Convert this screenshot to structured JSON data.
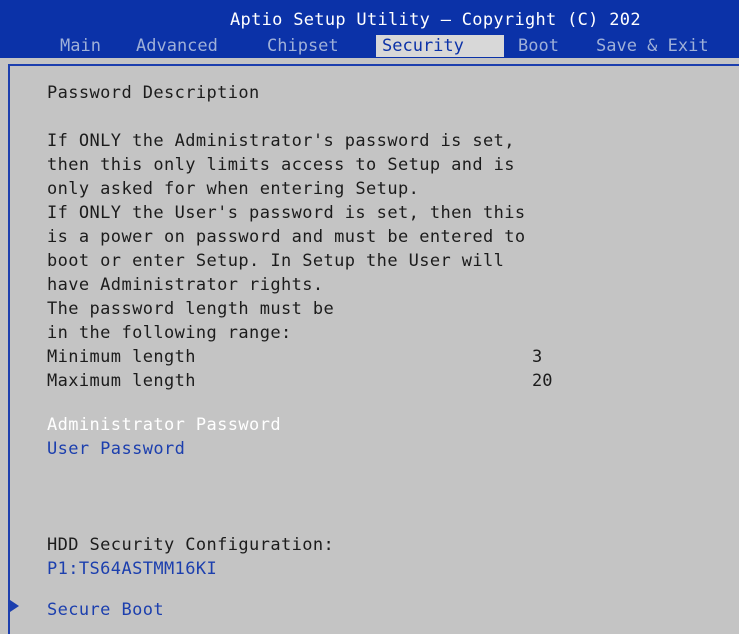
{
  "header": {
    "title": "Aptio Setup Utility – Copyright (C) 202",
    "tabs": [
      {
        "label": "Main"
      },
      {
        "label": "Advanced"
      },
      {
        "label": "Chipset"
      },
      {
        "label": "Security"
      },
      {
        "label": "Boot"
      },
      {
        "label": "Save & Exit"
      }
    ],
    "active_tab": "Security"
  },
  "description": {
    "heading": "Password Description",
    "lines": [
      "If ONLY the Administrator's password is set,",
      "then this only limits access to Setup and is",
      "only asked for when entering Setup.",
      "If ONLY the User's password is set, then this",
      "is a power on password and must be entered to",
      "boot or enter Setup. In Setup the User will",
      "have Administrator rights.",
      "The password length must be",
      "in the following range:"
    ],
    "min_label": "Minimum length",
    "min_value": "3",
    "max_label": "Maximum length",
    "max_value": "20"
  },
  "items": {
    "admin_password": "Administrator Password",
    "user_password": "User Password",
    "hdd_heading": "HDD Security Configuration:",
    "hdd_device": "P1:TS64ASTMM16KI",
    "secure_boot": "Secure Boot"
  },
  "colors": {
    "header_bg": "#0b32a8",
    "body_bg": "#c4c4c4",
    "selected_text": "#ffffff",
    "link_text": "#1c3fae"
  },
  "icons": {
    "submenu_arrow": "right-triangle-icon"
  }
}
